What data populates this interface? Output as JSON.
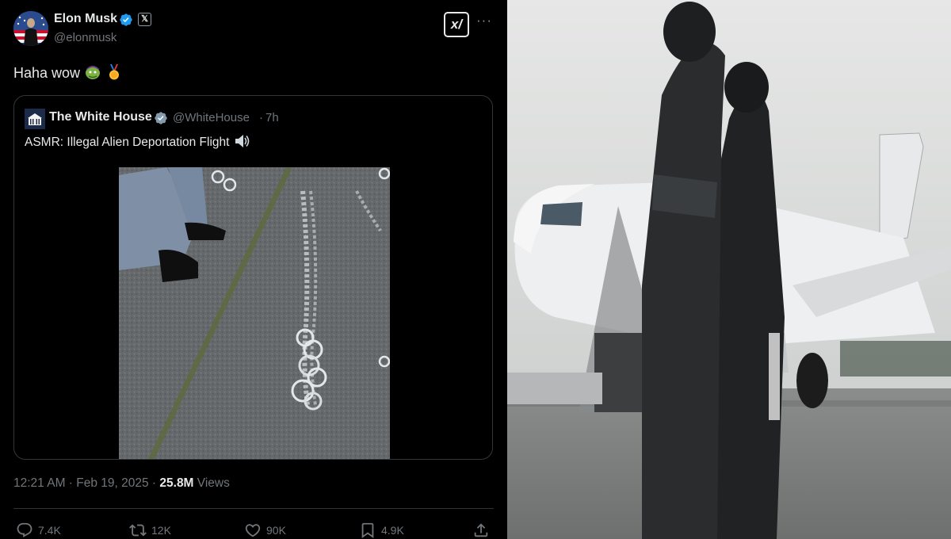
{
  "tweet": {
    "author_name": "Elon Musk",
    "handle": "@elonmusk",
    "affiliate_badge": "𝕏",
    "text": "Haha wow",
    "emojis": [
      "troll-emoji",
      "gold-medal-emoji"
    ],
    "timestamp": "12:21 AM · Feb 19, 2025 · ",
    "views_count": "25.8M",
    "views_label": " Views",
    "grok_label": "x/"
  },
  "quote": {
    "author_name": "The White House",
    "handle": "@WhiteHouse",
    "separator": "·",
    "time": "7h",
    "text": "ASMR: Illegal Alien Deportation Flight"
  },
  "actions": {
    "replies": "7.4K",
    "reposts": "12K",
    "likes": "90K",
    "bookmarks": "4.9K"
  },
  "colors": {
    "background": "#000000",
    "text_primary": "#e7e9ea",
    "text_secondary": "#71767b",
    "verified_blue": "#1d9bf0",
    "verified_gray": "#829aab",
    "border": "#333639"
  }
}
